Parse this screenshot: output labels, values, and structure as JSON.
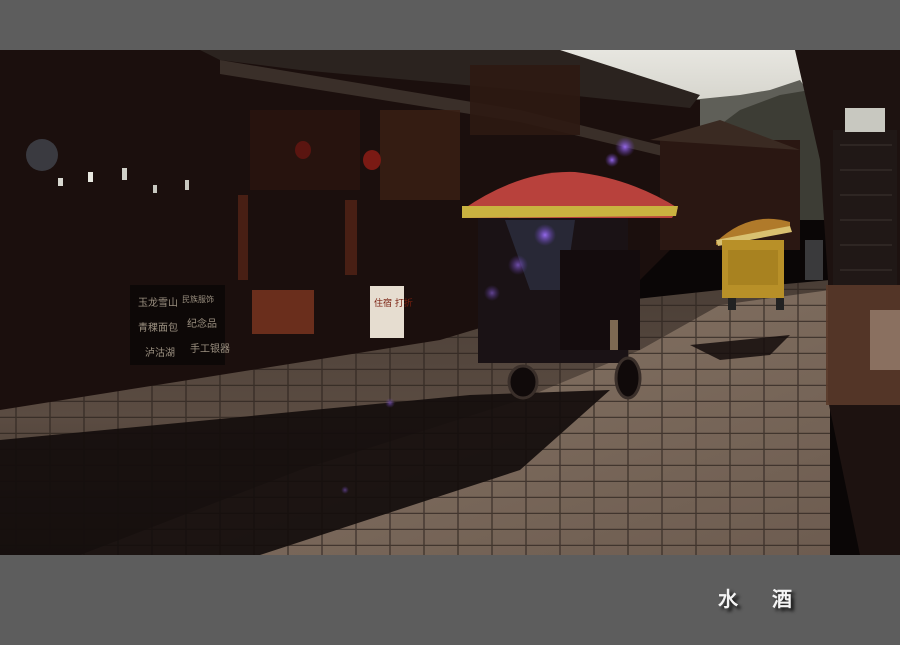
{
  "image": {
    "frame_color": "#5d5d5d",
    "description_icon": "photo-street-scene-icon"
  },
  "shop_signs": {
    "left_lines": [
      "玉龙雪山",
      "青稞面包",
      "泸沽湖"
    ],
    "right_lines": [
      "民族服饰",
      "纪念品",
      "手工银器"
    ],
    "small_sign": "住宿 打折"
  },
  "signature": {
    "char1": "水",
    "char2": "酒"
  }
}
